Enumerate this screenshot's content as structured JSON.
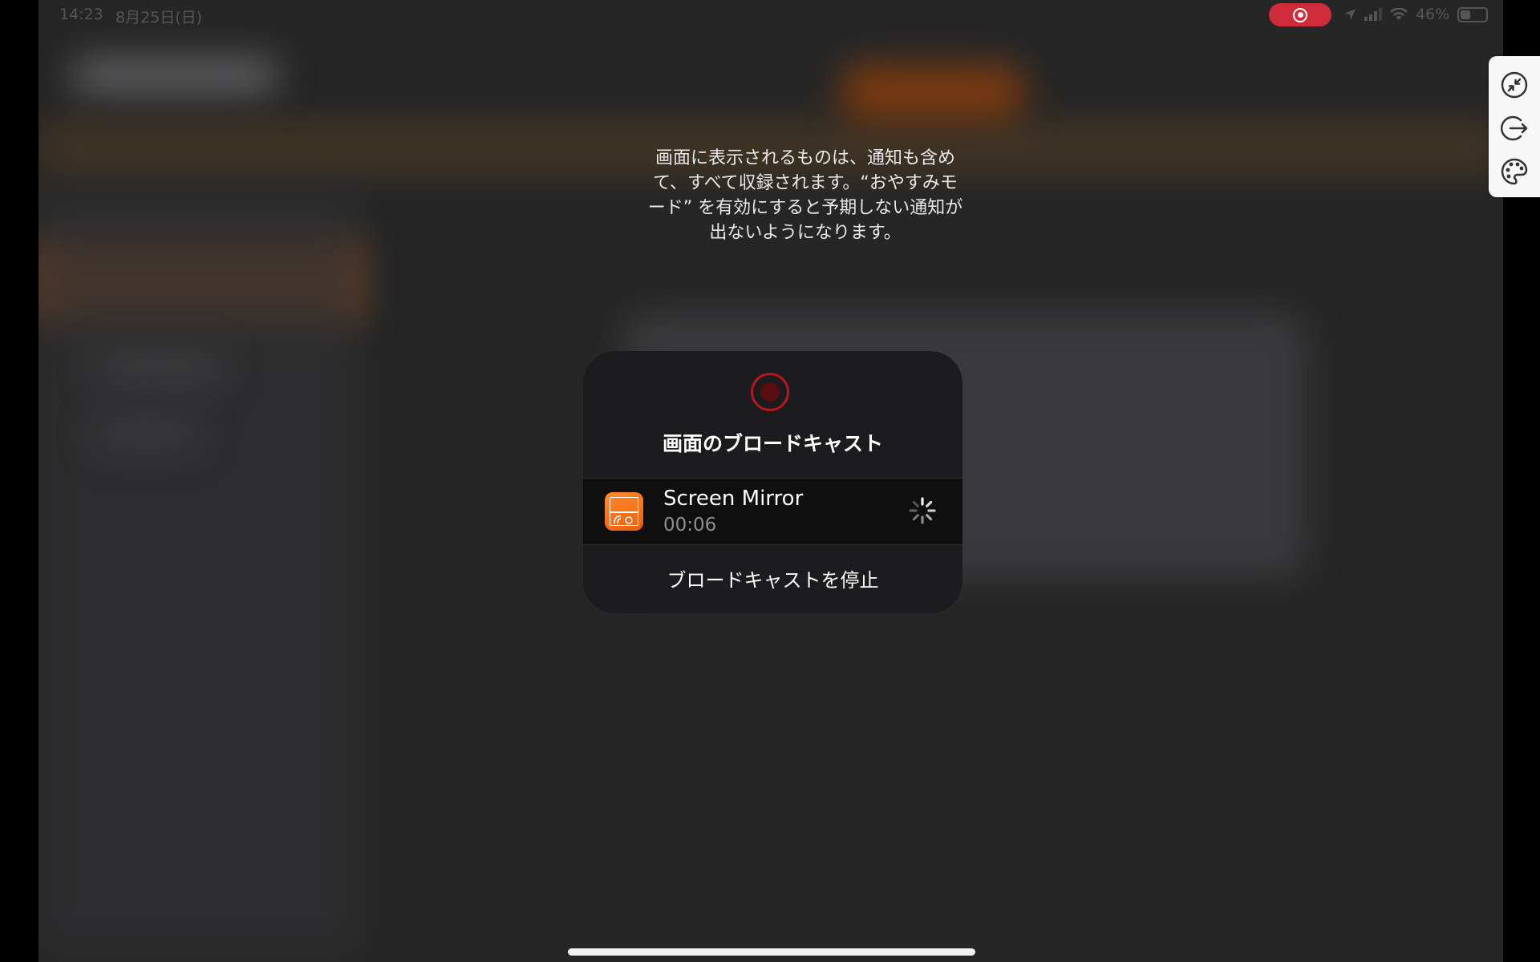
{
  "status_bar": {
    "time": "14:23",
    "date": "8月25日(日)",
    "battery_percent": "46%",
    "recording_color": "#cf2b3a"
  },
  "notice": {
    "text": "画面に表示されるものは、通知も含め\nて、すべて収録されます。“おやすみモ\nード” を有効にすると予期しない通知が\n出ないようになります。"
  },
  "broadcast_panel": {
    "icon": "record-icon",
    "title": "画面のブロードキャスト",
    "app": {
      "icon": "screen-mirror-app-icon",
      "name": "Screen Mirror",
      "elapsed": "00:06",
      "status_icon": "loading-spinner-icon"
    },
    "stop_label": "ブロードキャストを停止"
  },
  "side_toolbar": {
    "buttons": [
      {
        "icon": "minimize-arrows-icon"
      },
      {
        "icon": "exit-icon"
      },
      {
        "icon": "palette-icon"
      }
    ]
  },
  "colors": {
    "accent_orange": "#ee5d0f",
    "record_red": "#b5161f"
  }
}
